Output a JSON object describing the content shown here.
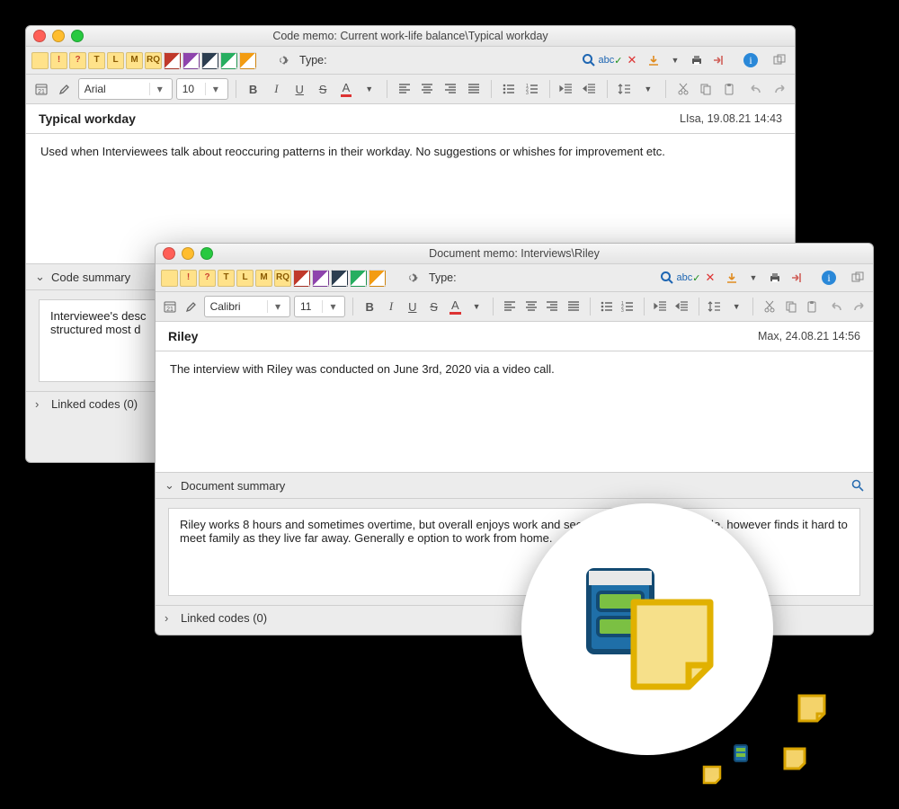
{
  "win1": {
    "title": "Code memo: Current work-life balance\\Typical workday",
    "type_label": "Type:",
    "font_name": "Arial",
    "font_size": "10",
    "heading": "Typical workday",
    "meta": "LIsa, 19.08.21 14:43",
    "body": "Used when Interviewees talk about reoccuring patterns in their workday. No suggestions or whishes for improvement etc.",
    "section_summary_label": "Code summary",
    "summary_text": "Interviewee's desc\nstructured most d",
    "linked_codes_label": "Linked codes (0)"
  },
  "win2": {
    "title": "Document memo: Interviews\\Riley",
    "type_label": "Type:",
    "font_name": "Calibri",
    "font_size": "11",
    "heading": "Riley",
    "meta": "Max, 24.08.21 14:56",
    "body": "The interview with Riley was conducted on June 3rd, 2020 via a video call.",
    "section_summary_label": "Document summary",
    "summary_text": "Riley works 8 hours and sometimes overtime, but overall enjoys work and see                                                                h relationships as a whole, however finds it hard to meet family as they live far away. Generally                                                              e option to work from home.",
    "linked_codes_label": "Linked codes (0)"
  },
  "icons": {
    "bold": "B",
    "italic": "I",
    "underline": "U",
    "strike": "S",
    "fontcolor": "A"
  },
  "tag_letters": [
    "!",
    "?",
    "T",
    "L",
    "M",
    "RQ"
  ]
}
